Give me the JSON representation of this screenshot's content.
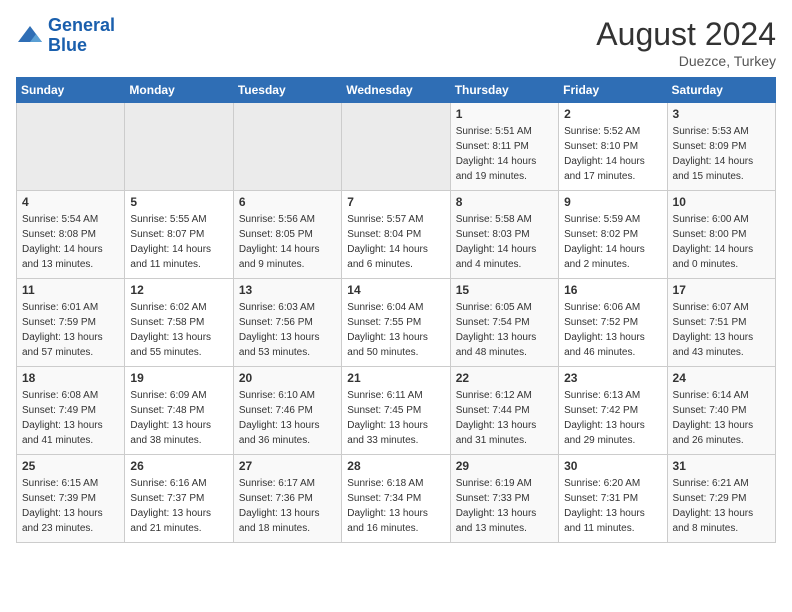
{
  "header": {
    "logo_line1": "General",
    "logo_line2": "Blue",
    "month_year": "August 2024",
    "location": "Duezce, Turkey"
  },
  "weekdays": [
    "Sunday",
    "Monday",
    "Tuesday",
    "Wednesday",
    "Thursday",
    "Friday",
    "Saturday"
  ],
  "weeks": [
    [
      {
        "day": "",
        "empty": true
      },
      {
        "day": "",
        "empty": true
      },
      {
        "day": "",
        "empty": true
      },
      {
        "day": "",
        "empty": true
      },
      {
        "day": "1",
        "sunrise": "5:51 AM",
        "sunset": "8:11 PM",
        "daylight": "14 hours and 19 minutes."
      },
      {
        "day": "2",
        "sunrise": "5:52 AM",
        "sunset": "8:10 PM",
        "daylight": "14 hours and 17 minutes."
      },
      {
        "day": "3",
        "sunrise": "5:53 AM",
        "sunset": "8:09 PM",
        "daylight": "14 hours and 15 minutes."
      }
    ],
    [
      {
        "day": "4",
        "sunrise": "5:54 AM",
        "sunset": "8:08 PM",
        "daylight": "14 hours and 13 minutes."
      },
      {
        "day": "5",
        "sunrise": "5:55 AM",
        "sunset": "8:07 PM",
        "daylight": "14 hours and 11 minutes."
      },
      {
        "day": "6",
        "sunrise": "5:56 AM",
        "sunset": "8:05 PM",
        "daylight": "14 hours and 9 minutes."
      },
      {
        "day": "7",
        "sunrise": "5:57 AM",
        "sunset": "8:04 PM",
        "daylight": "14 hours and 6 minutes."
      },
      {
        "day": "8",
        "sunrise": "5:58 AM",
        "sunset": "8:03 PM",
        "daylight": "14 hours and 4 minutes."
      },
      {
        "day": "9",
        "sunrise": "5:59 AM",
        "sunset": "8:02 PM",
        "daylight": "14 hours and 2 minutes."
      },
      {
        "day": "10",
        "sunrise": "6:00 AM",
        "sunset": "8:00 PM",
        "daylight": "14 hours and 0 minutes."
      }
    ],
    [
      {
        "day": "11",
        "sunrise": "6:01 AM",
        "sunset": "7:59 PM",
        "daylight": "13 hours and 57 minutes."
      },
      {
        "day": "12",
        "sunrise": "6:02 AM",
        "sunset": "7:58 PM",
        "daylight": "13 hours and 55 minutes."
      },
      {
        "day": "13",
        "sunrise": "6:03 AM",
        "sunset": "7:56 PM",
        "daylight": "13 hours and 53 minutes."
      },
      {
        "day": "14",
        "sunrise": "6:04 AM",
        "sunset": "7:55 PM",
        "daylight": "13 hours and 50 minutes."
      },
      {
        "day": "15",
        "sunrise": "6:05 AM",
        "sunset": "7:54 PM",
        "daylight": "13 hours and 48 minutes."
      },
      {
        "day": "16",
        "sunrise": "6:06 AM",
        "sunset": "7:52 PM",
        "daylight": "13 hours and 46 minutes."
      },
      {
        "day": "17",
        "sunrise": "6:07 AM",
        "sunset": "7:51 PM",
        "daylight": "13 hours and 43 minutes."
      }
    ],
    [
      {
        "day": "18",
        "sunrise": "6:08 AM",
        "sunset": "7:49 PM",
        "daylight": "13 hours and 41 minutes."
      },
      {
        "day": "19",
        "sunrise": "6:09 AM",
        "sunset": "7:48 PM",
        "daylight": "13 hours and 38 minutes."
      },
      {
        "day": "20",
        "sunrise": "6:10 AM",
        "sunset": "7:46 PM",
        "daylight": "13 hours and 36 minutes."
      },
      {
        "day": "21",
        "sunrise": "6:11 AM",
        "sunset": "7:45 PM",
        "daylight": "13 hours and 33 minutes."
      },
      {
        "day": "22",
        "sunrise": "6:12 AM",
        "sunset": "7:44 PM",
        "daylight": "13 hours and 31 minutes."
      },
      {
        "day": "23",
        "sunrise": "6:13 AM",
        "sunset": "7:42 PM",
        "daylight": "13 hours and 29 minutes."
      },
      {
        "day": "24",
        "sunrise": "6:14 AM",
        "sunset": "7:40 PM",
        "daylight": "13 hours and 26 minutes."
      }
    ],
    [
      {
        "day": "25",
        "sunrise": "6:15 AM",
        "sunset": "7:39 PM",
        "daylight": "13 hours and 23 minutes."
      },
      {
        "day": "26",
        "sunrise": "6:16 AM",
        "sunset": "7:37 PM",
        "daylight": "13 hours and 21 minutes."
      },
      {
        "day": "27",
        "sunrise": "6:17 AM",
        "sunset": "7:36 PM",
        "daylight": "13 hours and 18 minutes."
      },
      {
        "day": "28",
        "sunrise": "6:18 AM",
        "sunset": "7:34 PM",
        "daylight": "13 hours and 16 minutes."
      },
      {
        "day": "29",
        "sunrise": "6:19 AM",
        "sunset": "7:33 PM",
        "daylight": "13 hours and 13 minutes."
      },
      {
        "day": "30",
        "sunrise": "6:20 AM",
        "sunset": "7:31 PM",
        "daylight": "13 hours and 11 minutes."
      },
      {
        "day": "31",
        "sunrise": "6:21 AM",
        "sunset": "7:29 PM",
        "daylight": "13 hours and 8 minutes."
      }
    ]
  ]
}
